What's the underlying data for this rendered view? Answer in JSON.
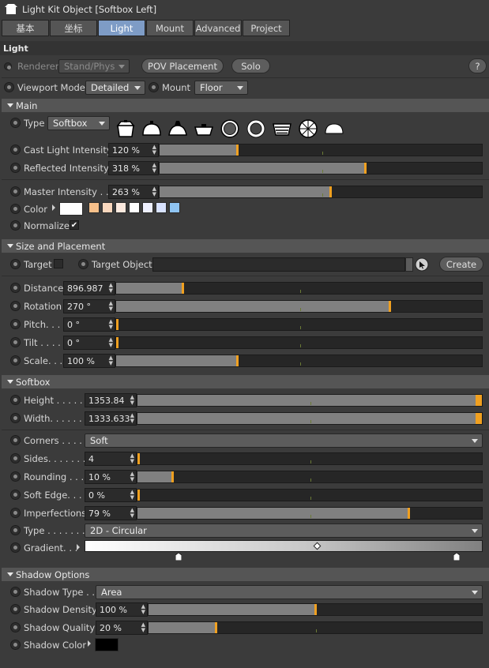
{
  "window": {
    "title": "Light Kit Object [Softbox Left]"
  },
  "tabs": [
    {
      "label": "基本"
    },
    {
      "label": "坐标"
    },
    {
      "label": "Light"
    },
    {
      "label": "Mount"
    },
    {
      "label": "Advanced"
    },
    {
      "label": "Project"
    }
  ],
  "panel": {
    "title": "Light"
  },
  "toolbar": {
    "renderer_label": "Renderer",
    "renderer_value": "Stand/Phys",
    "pov_button": "POV Placement",
    "solo_button": "Solo",
    "help_button": "?"
  },
  "viewport": {
    "mode_label": "Viewport Mode",
    "mode_value": "Detailed",
    "mount_label": "Mount",
    "mount_value": "Floor"
  },
  "sections": {
    "main": "Main",
    "size": "Size and Placement",
    "softbox": "Softbox",
    "shadow": "Shadow Options"
  },
  "main": {
    "type_label": "Type",
    "type_value": "Softbox",
    "type_icons": [
      "softbox-box-icon",
      "dome-light-icon",
      "spot-dome-icon",
      "flat-panel-icon",
      "ring-light-icon",
      "ring-light-bold-icon",
      "striped-panel-icon",
      "umbrella-icon",
      "half-dome-icon"
    ],
    "cast_label": "Cast Light Intensity",
    "cast_value": "120 %",
    "cast_level": 0.24,
    "reflected_label": "Reflected Intensity",
    "reflected_value": "318 %",
    "reflected_level": 0.64,
    "master_label": "Master Intensity . .",
    "master_value": "263 %",
    "master_level": 0.53,
    "color_label": "Color",
    "color_value": "#ffffff",
    "color_presets": [
      "#f7c08a",
      "#f9d7bd",
      "#fbe9de",
      "#ffffff",
      "#eef0ff",
      "#d8e2ff",
      "#8fc4f2"
    ],
    "normalize_label": "Normalize",
    "normalize_checked": "✔"
  },
  "size": {
    "target_label": "Target",
    "target_object_label": "Target Object",
    "target_object_value": "",
    "create_button": "Create",
    "distance_label": "Distance",
    "distance_value": "896.987",
    "distance_level": 0.18,
    "rotation_label": "Rotation",
    "rotation_value": "270 °",
    "rotation_level": 0.75,
    "pitch_label": "Pitch. . .",
    "pitch_value": "0 °",
    "pitch_level": 0.0,
    "tilt_label": "Tilt  . . . .",
    "tilt_value": "0 °",
    "tilt_level": 0.0,
    "scale_label": "Scale. . .",
    "scale_value": "100 %",
    "scale_level": 0.33
  },
  "softbox": {
    "height_label": "Height . . . . . .",
    "height_value": "1353.84",
    "height_level": 1.0,
    "width_label": "Width. . . . . . .",
    "width_value": "1333.633",
    "width_level": 1.0,
    "corners_label": "Corners . . . . .",
    "corners_value": "Soft",
    "sides_label": "Sides. . . . . . . .",
    "sides_value": "4",
    "sides_level": 0.0,
    "rounding_label": "Rounding  . . .",
    "rounding_value": "10 %",
    "rounding_level": 0.1,
    "softedge_label": "Soft Edge. . . .",
    "softedge_value": "0 %",
    "softedge_level": 0.0,
    "imperfections_label": "Imperfections",
    "imperfections_value": "79 %",
    "imperfections_level": 0.79,
    "type_label": "Type . . . . . . . .",
    "type_value": "2D - Circular",
    "gradient_label": "Gradient. . ."
  },
  "shadow": {
    "type_label": "Shadow Type  . .",
    "type_value": "Area",
    "density_label": "Shadow Density",
    "density_value": "100 %",
    "density_level": 0.5,
    "quality_label": "Shadow Quality",
    "quality_value": "20 %",
    "quality_level": 0.2,
    "color_label": "Shadow Color",
    "color_value": "#000000"
  }
}
